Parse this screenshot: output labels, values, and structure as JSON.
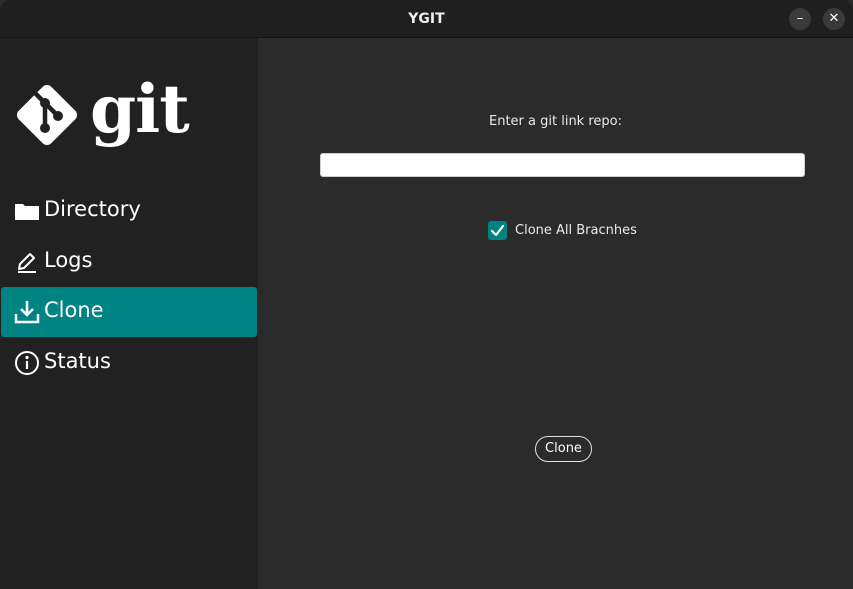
{
  "window": {
    "title": "YGIT",
    "minimize_glyph": "–",
    "close_glyph": "✕"
  },
  "sidebar": {
    "logo_text": "git",
    "items": [
      {
        "label": "Directory",
        "icon": "folder-icon",
        "active": false
      },
      {
        "label": "Logs",
        "icon": "pencil-icon",
        "active": false
      },
      {
        "label": "Clone",
        "icon": "download-icon",
        "active": true
      },
      {
        "label": "Status",
        "icon": "info-icon",
        "active": false
      }
    ]
  },
  "main": {
    "prompt": "Enter a git link repo:",
    "repo_input_value": "",
    "repo_input_placeholder": "",
    "clone_all_label": "Clone All Bracnhes",
    "clone_all_checked": true,
    "clone_button_label": "Clone"
  },
  "colors": {
    "accent": "#008383",
    "sidebar_bg": "#212121",
    "main_bg": "#2b2b2b",
    "titlebar_bg": "#1f1f1f"
  }
}
